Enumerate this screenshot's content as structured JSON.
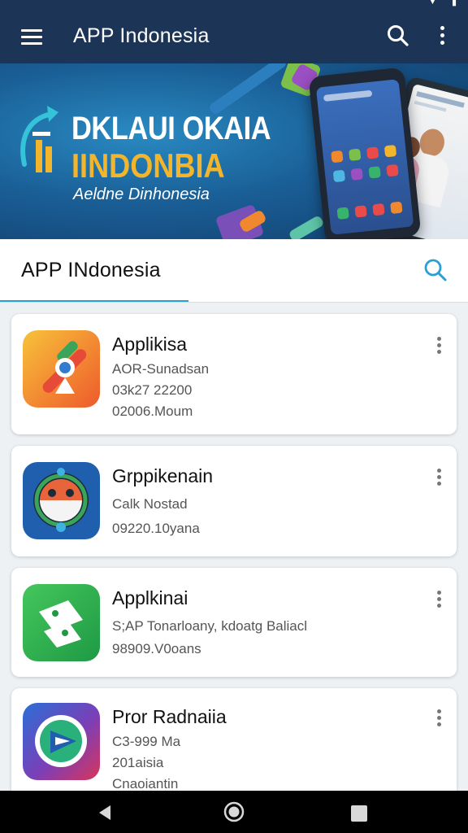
{
  "app_bar": {
    "title": "APP Indonesia",
    "icons": [
      "menu-icon",
      "search-icon",
      "more-vert-icon"
    ]
  },
  "banner": {
    "headline_1": "DKLAUI OKAIA",
    "headline_2": "IINDONBIA",
    "subtitle": "Aeldne Dinhonesia"
  },
  "search_tab": {
    "title": "APP INdonesia",
    "icon": "search-icon"
  },
  "apps": [
    {
      "title": "Applikisa",
      "lines": [
        "AOR-Sunadsan",
        "03k27 22200",
        "02006.Moum"
      ]
    },
    {
      "title": "Grppikenain",
      "lines": [
        "Calk Nostad",
        "09220.10yana"
      ]
    },
    {
      "title": "Applkinai",
      "lines": [
        "S;AP Tonarloany, kdoatg Baliacl",
        "98909.V0oans"
      ]
    },
    {
      "title": "Pror Radnaiia",
      "lines": [
        "C3-999 Ma",
        "201aisia",
        "Cnaoiantin"
      ]
    }
  ],
  "colors": {
    "app_bar": "#1c3556",
    "accent": "#2a9fd3",
    "banner_gold": "#f3b52b"
  },
  "nav_icons": [
    "back-icon",
    "home-icon",
    "recents-icon"
  ]
}
